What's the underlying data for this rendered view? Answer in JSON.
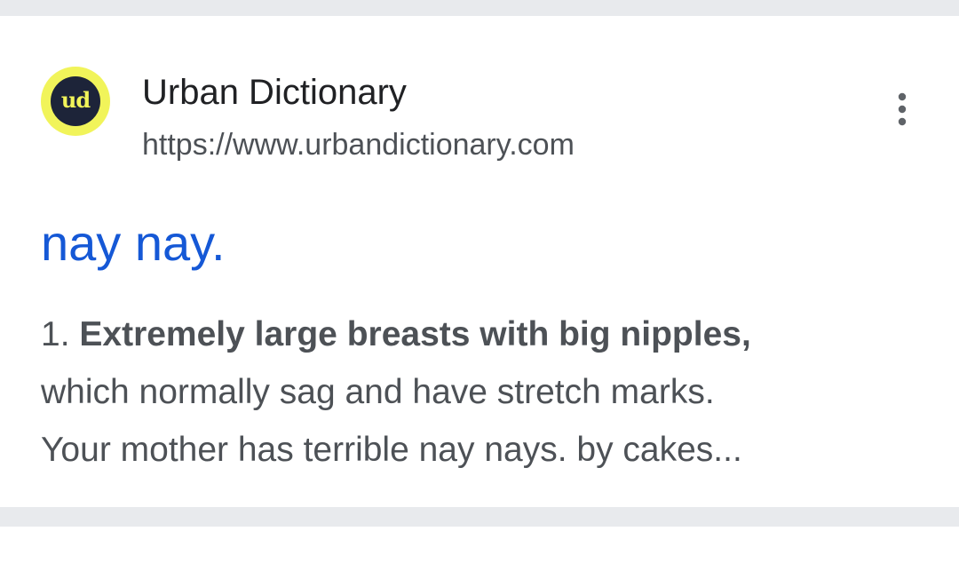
{
  "result": {
    "favicon_text": "ud",
    "favicon_icon": "urban-dictionary-logo",
    "site_name": "Urban Dictionary",
    "site_url": "https://www.urbandictionary.com",
    "more_icon": "more-vert-icon",
    "title": "nay nay.",
    "snippet": {
      "number": "1.",
      "bold_text": "Extremely large breasts with big nipples,",
      "line2": "which normally sag and have stretch marks.",
      "line3": "Your mother has terrible nay nays. by cakes..."
    }
  },
  "colors": {
    "background": "#e8eaed",
    "card": "#ffffff",
    "title_link": "#1558d6",
    "site_name": "#202124",
    "body_text": "#4d5156",
    "favicon_ring": "#f1f45a",
    "favicon_center": "#1d2439"
  }
}
